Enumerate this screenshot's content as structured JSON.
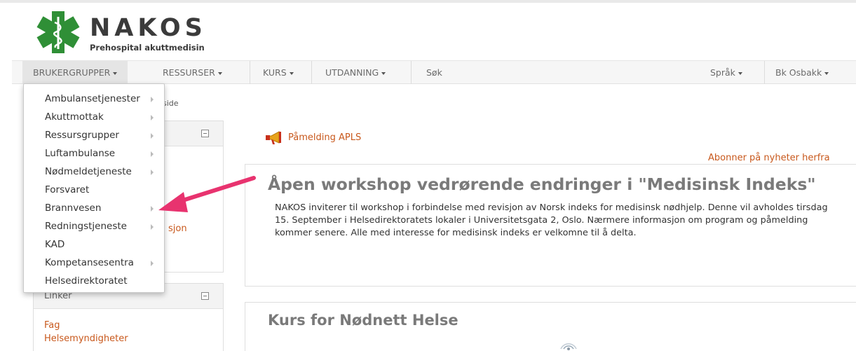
{
  "logo": {
    "title": "NAKOS",
    "subtitle": "Prehospital akuttmedisin",
    "icon": "star-of-life-icon",
    "brand_color": "#2f8f36"
  },
  "navbar": {
    "items": [
      {
        "label": "BRUKERGRUPPER",
        "has_caret": true,
        "active": true
      },
      {
        "label": "RESSURSER",
        "has_caret": true
      },
      {
        "label": "KURS",
        "has_caret": true
      },
      {
        "label": "UTDANNING",
        "has_caret": true
      },
      {
        "label": "Søk",
        "has_caret": false
      }
    ],
    "right_items": [
      {
        "label": "Språk",
        "has_caret": true
      },
      {
        "label": "Bk Osbakk",
        "has_caret": true
      }
    ]
  },
  "breadcrumb": {
    "text": "side"
  },
  "dropdown": {
    "items": [
      {
        "label": "Ambulansetjenester",
        "has_submenu": true
      },
      {
        "label": "Akuttmottak",
        "has_submenu": true
      },
      {
        "label": "Ressursgrupper",
        "has_submenu": true
      },
      {
        "label": "Luftambulanse",
        "has_submenu": true
      },
      {
        "label": "Nødmeldetjeneste",
        "has_submenu": true
      },
      {
        "label": "Forsvaret",
        "has_submenu": false
      },
      {
        "label": "Brannvesen",
        "has_submenu": true
      },
      {
        "label": "Redningstjeneste",
        "has_submenu": true
      },
      {
        "label": "KAD",
        "has_submenu": false
      },
      {
        "label": "Kompetansesentra",
        "has_submenu": true
      },
      {
        "label": "Helsedirektoratet",
        "has_submenu": false
      }
    ]
  },
  "sidebar": {
    "panel1": {
      "partial_links": [
        "s",
        "sjon"
      ]
    },
    "panel2": {
      "title": "Linker",
      "links": [
        "Fag",
        "Helsemyndigheter"
      ]
    }
  },
  "main": {
    "announcement": {
      "label": "Påmelding APLS",
      "icon": "megaphone-icon"
    },
    "subscribe_link": "Abonner på nyheter herfra",
    "articles": [
      {
        "title": "Åpen workshop vedrørende endringer i \"Medisinsk Indeks\"",
        "body": "NAKOS inviterer til workshop i forbindelse med revisjon av Norsk indeks for medisinsk nødhjelp. Denne vil avholdes tirsdag 15. September i Helsedirektoratets lokaler i Universitetsgata 2, Oslo. Nærmere informasjon om program og påmelding kommer senere. Alle med interesse for medisinsk indeks er velkomne til å delta."
      },
      {
        "title": "Kurs for Nødnett Helse"
      }
    ]
  },
  "colors": {
    "link": "#c8581c",
    "annotation_arrow": "#e8336f",
    "article_title": "#7a7a7a"
  }
}
